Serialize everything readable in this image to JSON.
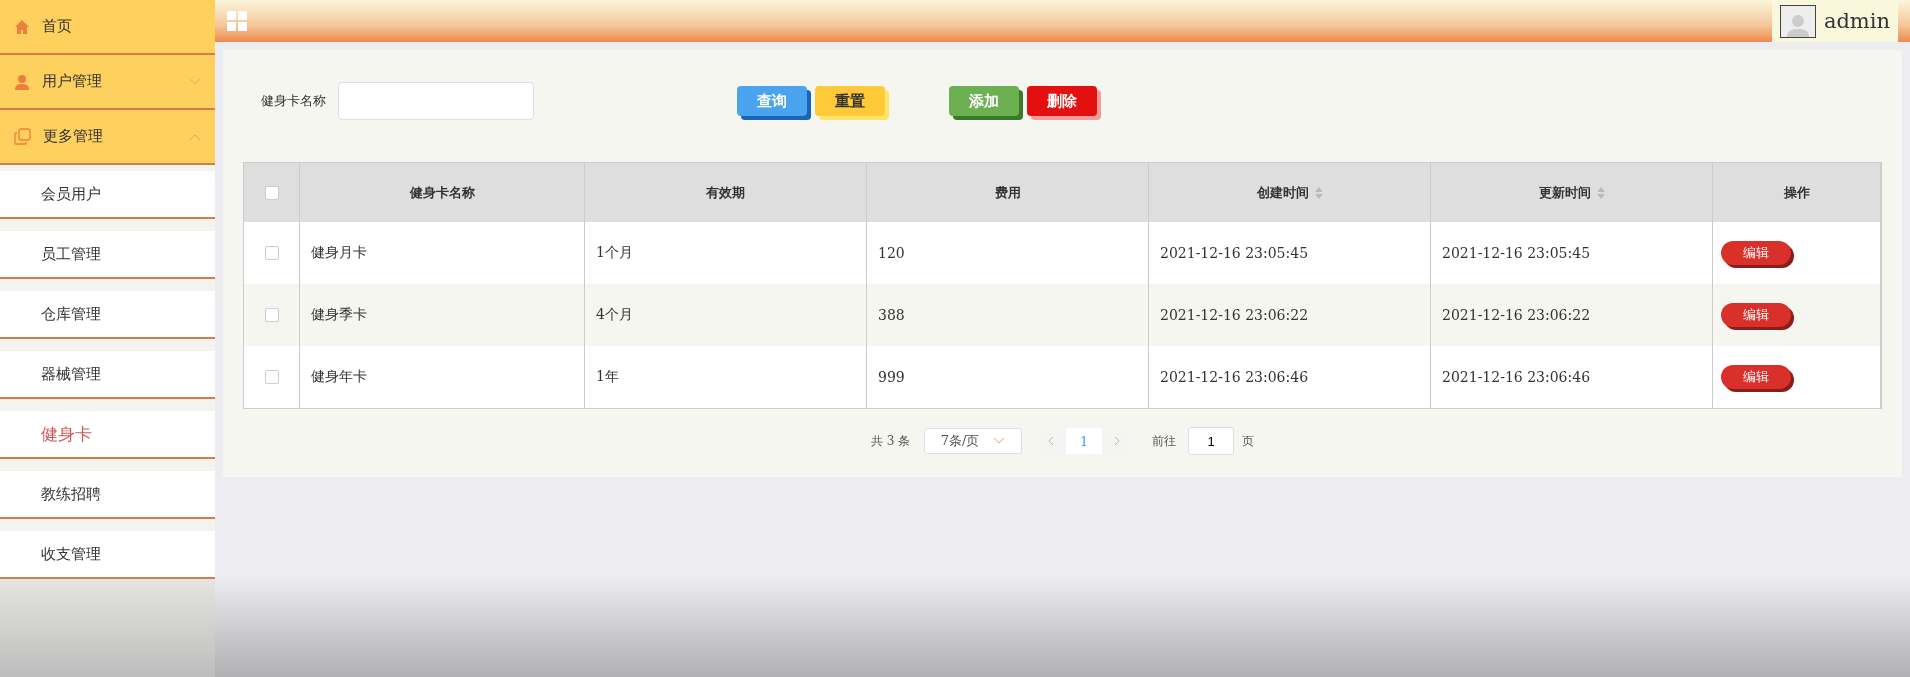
{
  "sidebar": {
    "items": [
      {
        "label": "首页"
      },
      {
        "label": "用户管理",
        "expanded": false
      },
      {
        "label": "更多管理",
        "expanded": true,
        "children": [
          {
            "label": "会员用户",
            "selected": false
          },
          {
            "label": "员工管理",
            "selected": false
          },
          {
            "label": "仓库管理",
            "selected": false
          },
          {
            "label": "器械管理",
            "selected": false
          },
          {
            "label": "健身卡",
            "selected": true
          },
          {
            "label": "教练招聘",
            "selected": false
          },
          {
            "label": "收支管理",
            "selected": false
          }
        ]
      }
    ]
  },
  "topbar": {
    "user": "admin"
  },
  "search": {
    "label": "健身卡名称"
  },
  "buttons": [
    {
      "label": "查询",
      "kind": "search"
    },
    {
      "label": "重置",
      "kind": "reset"
    },
    {
      "label": "添加",
      "kind": "add"
    },
    {
      "label": "删除",
      "kind": "delete"
    }
  ],
  "table": {
    "all_checked": false,
    "columns": [
      {
        "label": "健身卡名称",
        "sortable": false
      },
      {
        "label": "有效期",
        "sortable": false
      },
      {
        "label": "费用",
        "sortable": false
      },
      {
        "label": "创建时间",
        "sortable": true
      },
      {
        "label": "更新时间",
        "sortable": true
      },
      {
        "label": "操作",
        "sortable": false
      }
    ],
    "rows": [
      {
        "checked": false,
        "cells": [
          "健身月卡",
          "1个月",
          "120",
          "2021-12-16 23:05:45",
          "2021-12-16 23:05:45"
        ],
        "action": "编辑"
      },
      {
        "checked": false,
        "cells": [
          "健身季卡",
          "4个月",
          "388",
          "2021-12-16 23:06:22",
          "2021-12-16 23:06:22"
        ],
        "action": "编辑"
      },
      {
        "checked": false,
        "cells": [
          "健身年卡",
          "1年",
          "999",
          "2021-12-16 23:06:46",
          "2021-12-16 23:06:46"
        ],
        "action": "编辑"
      }
    ]
  },
  "pagination": {
    "total": "共 3 条",
    "page_size": "7条/页",
    "pages": [
      {
        "label": "1",
        "selected": true
      }
    ],
    "goto_label": "前往",
    "goto_value": "1",
    "goto_suffix": "页"
  }
}
